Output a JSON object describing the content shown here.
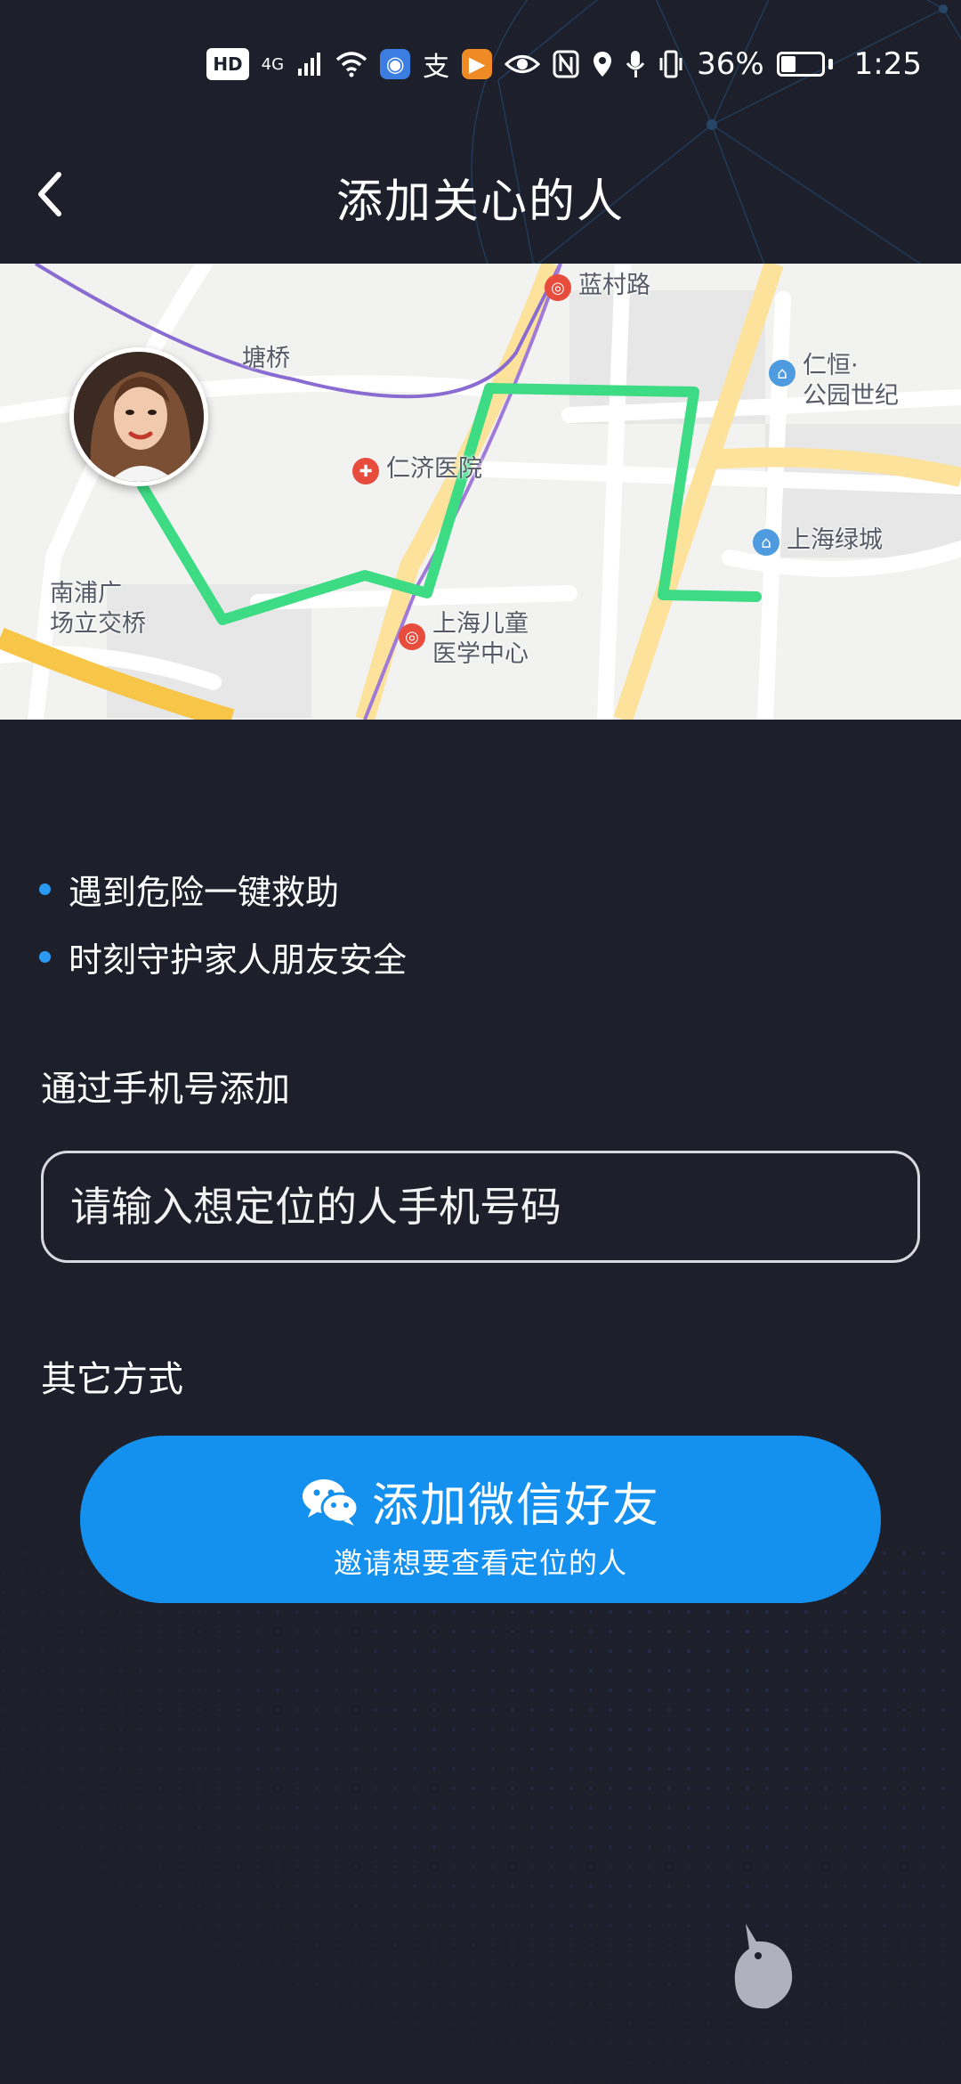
{
  "status_bar": {
    "network": "4G",
    "signal_icon": "signal-bars-icon",
    "wifi_icon": "wifi-icon",
    "battery_percent": "36%",
    "battery_level": 0.36,
    "time": "1:25",
    "hd_label": "HD",
    "alipay_glyph": "支"
  },
  "header": {
    "title": "添加关心的人",
    "back_icon": "chevron-left-icon"
  },
  "map": {
    "labels": {
      "lancun_road": "蓝村路",
      "tangqiao": "塘桥",
      "renheng": "仁恒·\n公园世纪",
      "renji_hospital": "仁济医院",
      "shanghai_lvcheng": "上海绿城",
      "nanpu_bridge": "南浦广\n场立交桥",
      "childrens_medical": "上海儿童\n医学中心"
    },
    "route_color": "#3ddc84",
    "metro_color": "#8a6bd1",
    "major_road_color": "#ffd36a"
  },
  "features": [
    {
      "text": "遇到危险一键救助"
    },
    {
      "text": "时刻守护家人朋友安全"
    }
  ],
  "phone_section": {
    "title": "通过手机号添加",
    "placeholder": "请输入想定位的人手机号码"
  },
  "other_section": {
    "title": "其它方式"
  },
  "wechat_button": {
    "label": "添加微信好友",
    "sublabel": "邀请想要查看定位的人",
    "icon": "wechat-icon",
    "color": "#1490ee"
  },
  "colors": {
    "background": "#1d1f2b",
    "accent": "#2b9af3"
  }
}
